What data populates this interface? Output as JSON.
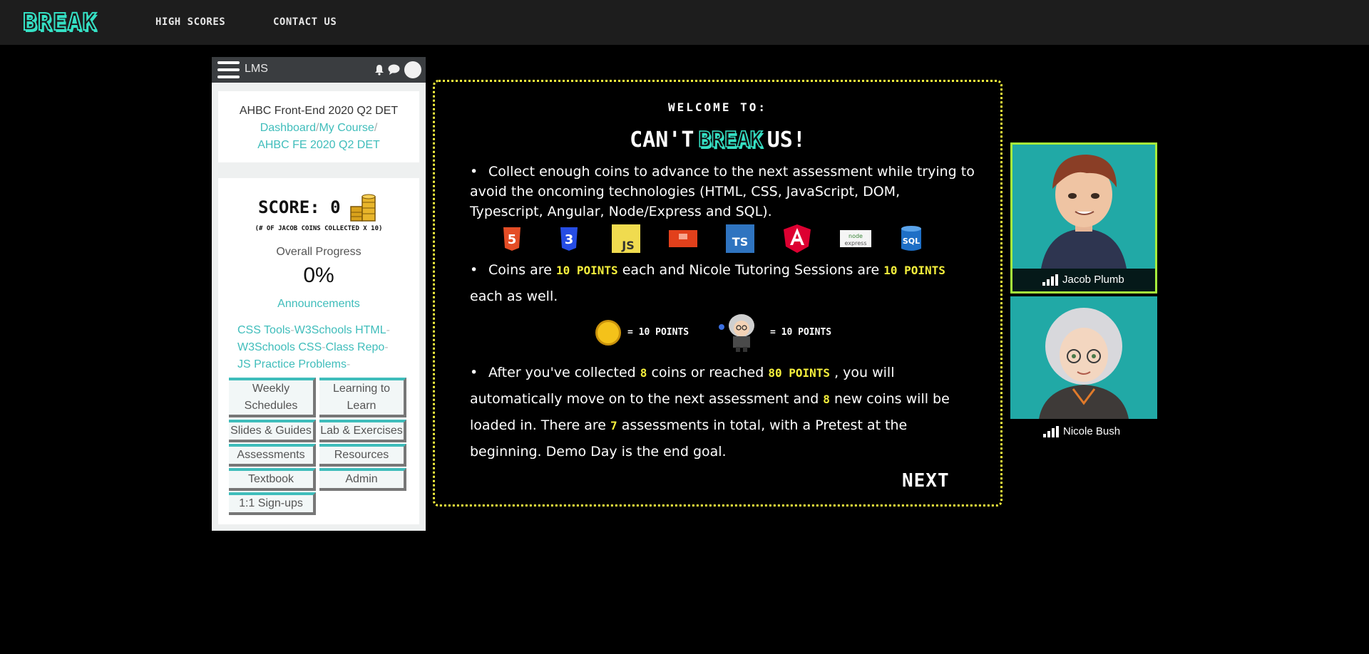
{
  "nav": {
    "logo": "BREAK",
    "links": [
      "HIGH SCORES",
      "CONTACT US"
    ]
  },
  "lms": {
    "title": "LMS",
    "course_name": "AHBC Front-End 2020 Q2 DET",
    "breadcrumb_1": "Dashboard",
    "breadcrumb_2": "My Course",
    "breadcrumb_3": "AHBC FE 2020 Q2 DET",
    "score_label": "SCORE: 0",
    "score_sub": "(# OF JACOB COINS COLLECTED X 10)",
    "progress_label": "Overall Progress",
    "progress_value": "0%",
    "announcements": "Announcements",
    "links": [
      "CSS Tools",
      "W3Schools HTML",
      "W3Schools CSS",
      "Class Repo",
      "JS Practice Problems"
    ],
    "buttons": [
      "Weekly Schedules",
      "Learning to Learn",
      "Slides & Guides",
      "Lab & Exercises",
      "Assessments",
      "Resources",
      "Textbook",
      "Admin",
      "1:1 Sign-ups"
    ]
  },
  "welcome": {
    "title": "WELCOME TO:",
    "cant": "CAN'T",
    "break": "BREAK",
    "us": "US!",
    "p1": "Collect enough coins to advance to the next assessment while trying to avoid the oncoming technologies (HTML, CSS, JavaScript, DOM, Typescript, Angular, Node/Express and SQL).",
    "p2_a": "Coins are",
    "p2_hl1": "10 POINTS",
    "p2_b": "each and Nicole Tutoring Sessions are",
    "p2_hl2": "10 POINTS",
    "p2_c": "each as well.",
    "coin_eq": "= 10 POINTS",
    "nicole_eq": "= 10 POINTS",
    "p3_a": "After you've collected",
    "p3_hl1": "8",
    "p3_b": "coins or reached",
    "p3_hl2": "80 POINTS",
    "p3_c": ", you will automatically move on to the next assessment and",
    "p3_hl3": "8",
    "p3_d": "new coins will be loaded in. There are",
    "p3_hl4": "7",
    "p3_e": "assessments in total, with a Pretest at the beginning. Demo Day is the end goal.",
    "next": "NEXT",
    "tech_icons": [
      "html5-icon",
      "css3-icon",
      "js-icon",
      "dom-icon",
      "typescript-icon",
      "angular-icon",
      "node-express-icon",
      "sql-icon"
    ]
  },
  "participants": [
    {
      "name": "Jacob Plumb"
    },
    {
      "name": "Nicole Bush"
    }
  ],
  "colors": {
    "accent_teal": "#35e0c4",
    "highlight_yellow": "#f5ef3c",
    "link_teal": "#3fbdbb",
    "active_border": "#a6f03c"
  }
}
